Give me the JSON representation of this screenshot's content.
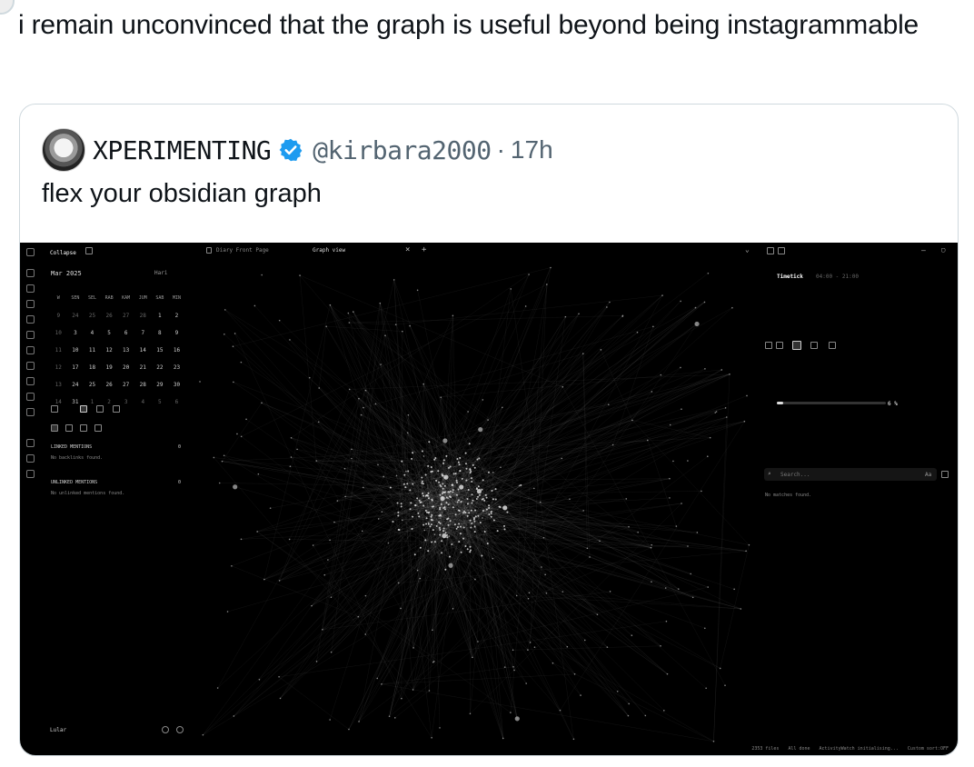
{
  "tweet": {
    "text": "i remain unconvinced that the graph is useful beyond being instagrammable"
  },
  "quoted": {
    "display_name": "XPERIMENTING",
    "handle": "@kirbara2000",
    "separator": "·",
    "time": "17h",
    "text": "flex your obsidian graph",
    "verified_color": "#1d9bf0"
  },
  "obsidian": {
    "left_panel": {
      "collapse_label": "Collapse",
      "month": "Mar 2025",
      "today_label": "Hari",
      "weekdays": [
        "W",
        "SEN",
        "SEL",
        "RAB",
        "KAM",
        "JUM",
        "SAB",
        "MIN"
      ],
      "weeks": [
        [
          "9",
          "24",
          "25",
          "26",
          "27",
          "28",
          "1",
          "2"
        ],
        [
          "10",
          "3",
          "4",
          "5",
          "6",
          "7",
          "8",
          "9"
        ],
        [
          "11",
          "10",
          "11",
          "12",
          "13",
          "14",
          "15",
          "16"
        ],
        [
          "12",
          "17",
          "18",
          "19",
          "20",
          "21",
          "22",
          "23"
        ],
        [
          "13",
          "24",
          "25",
          "26",
          "27",
          "28",
          "29",
          "30"
        ],
        [
          "14",
          "31",
          "1",
          "2",
          "3",
          "4",
          "5",
          "6"
        ]
      ],
      "linked_heading": "LINKED MENTIONS",
      "linked_count": "0",
      "linked_empty": "No backlinks found.",
      "unlinked_heading": "UNLINKED MENTIONS",
      "unlinked_count": "0",
      "unlinked_empty": "No unlinked mentions found.",
      "vault_name": "Lular"
    },
    "tabs": {
      "tab1": "Diary Front Page",
      "tab2": "Graph view"
    },
    "right_panel": {
      "timetick_label": "Timetick",
      "timetick_range": "04:00 - 21:00",
      "progress_text": "6 %",
      "progress_fraction": 0.06,
      "search_placeholder": "Search...",
      "match_case": "Aa",
      "no_matches": "No matches found."
    },
    "status_bar": {
      "files": "2353 files",
      "sync": "All done",
      "activity": "ActivityWatch initialising...",
      "sort": "Custom sort:OFF"
    }
  }
}
